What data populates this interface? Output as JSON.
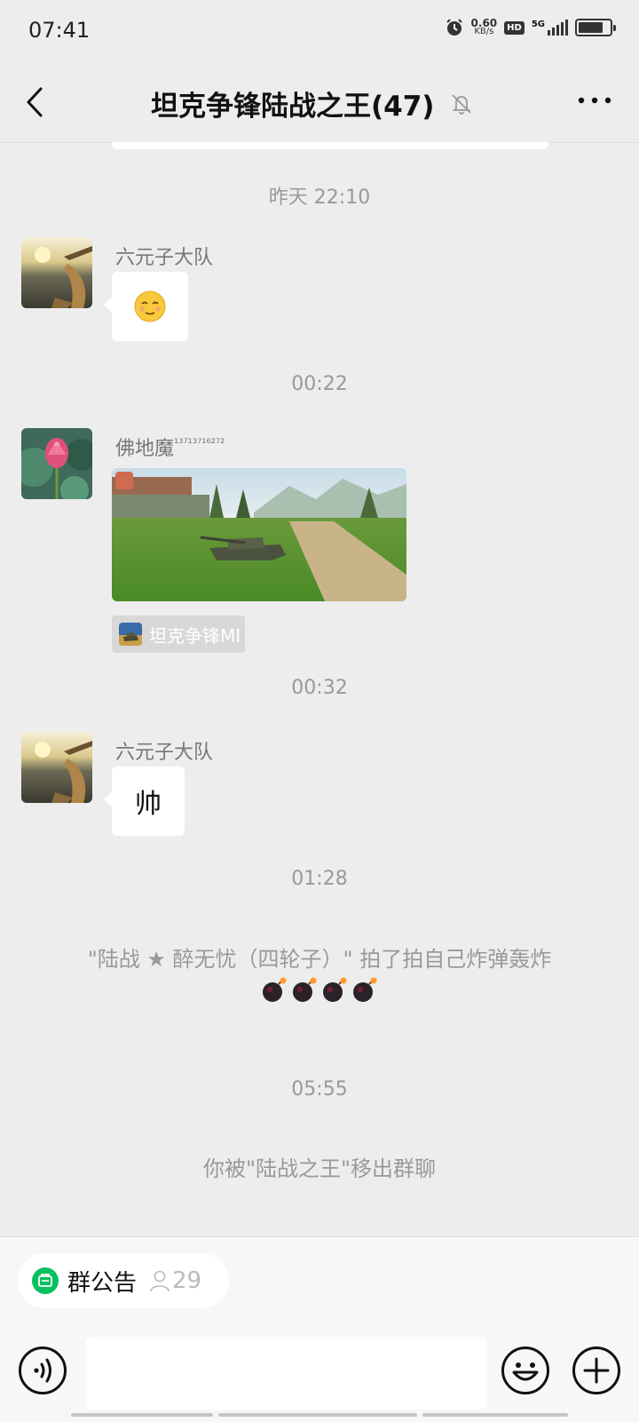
{
  "status_bar": {
    "time": "07:41",
    "net_speed_value": "0.60",
    "net_speed_unit": "KB/s",
    "hd_label": "HD",
    "network_label": "5G"
  },
  "header": {
    "title": "坦克争锋陆战之王(47)"
  },
  "messages": {
    "ts1": "昨天 22:10",
    "msg1": {
      "sender": "六元子大队"
    },
    "ts2": "00:22",
    "msg2": {
      "sender": "佛地魔",
      "sender_suffix": "¹³⁷¹³⁷¹⁶²⁷²",
      "source_label": "坦克争锋MI"
    },
    "ts3": "00:32",
    "msg3": {
      "sender": "六元子大队",
      "text": "帅"
    },
    "ts4": "01:28",
    "pat_notice": "\"陆战 ★ 醉无忧（四轮子）\" 拍了拍自己炸弹轰炸",
    "ts5": "05:55",
    "removed_notice": "你被\"陆战之王\"移出群聊"
  },
  "bottom": {
    "notice_label": "群公告",
    "member_count": "29"
  },
  "icons": {
    "back": "chevron-left-icon",
    "mute": "bell-off-icon",
    "more": "more-dots-icon",
    "voice": "voice-icon",
    "emoji": "emoji-icon",
    "plus": "plus-icon",
    "notice": "announcement-icon",
    "member": "person-icon",
    "bomb": "bomb-emoji"
  },
  "colors": {
    "background": "#ededed",
    "bubble": "#ffffff",
    "notice_green": "#07c160",
    "muted_text": "#999999"
  }
}
